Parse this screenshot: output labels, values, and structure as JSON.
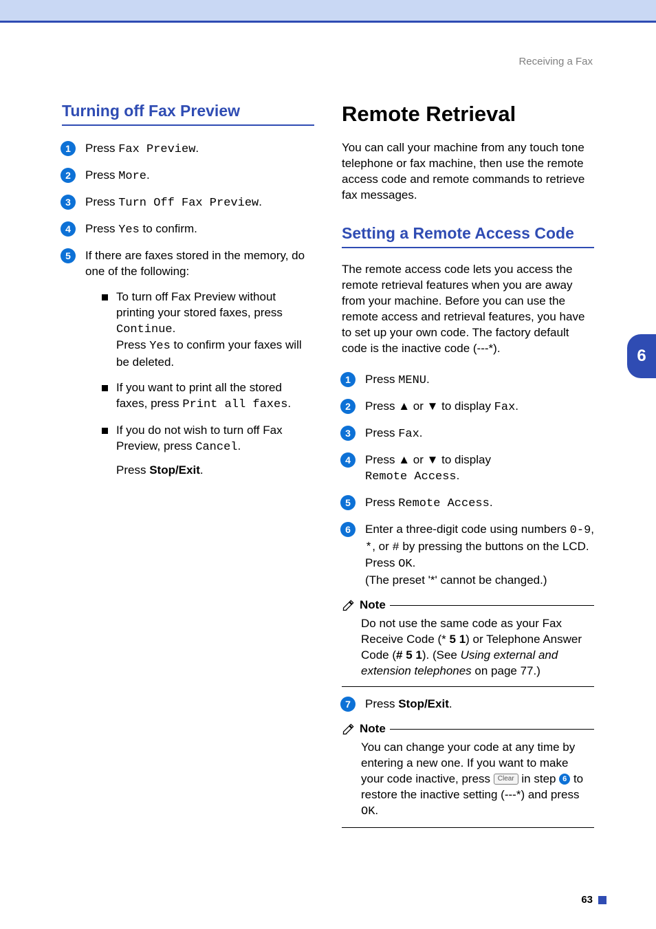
{
  "header": {
    "section": "Receiving a Fax"
  },
  "left": {
    "heading": "Turning off Fax Preview",
    "steps": {
      "s1": {
        "pre": "Press ",
        "mono": "Fax Preview",
        "post": "."
      },
      "s2": {
        "pre": "Press ",
        "mono": "More",
        "post": "."
      },
      "s3": {
        "pre": "Press ",
        "mono": "Turn Off Fax Preview",
        "post": "."
      },
      "s4": {
        "pre": "Press ",
        "mono": "Yes",
        "post": " to confirm."
      },
      "s5": "If there are faxes stored in the memory, do one of the following:"
    },
    "bullets": {
      "b1": {
        "l1a": "To turn off Fax Preview without printing your stored faxes, press ",
        "l1m": "Continue",
        "l1p": ".",
        "l2a": "Press ",
        "l2m": "Yes",
        "l2p": " to confirm your faxes will be deleted."
      },
      "b2": {
        "a": "If you want to print all the stored faxes, press ",
        "m": "Print all faxes",
        "p": "."
      },
      "b3": {
        "a": "If you do not wish to turn off Fax Preview, press ",
        "m": "Cancel",
        "p": ".",
        "l2a": "Press ",
        "l2b": "Stop/Exit",
        "l2p": "."
      }
    }
  },
  "right": {
    "h1": "Remote Retrieval",
    "intro": "You can call your machine from any touch tone telephone or fax machine, then use the remote access code and remote commands to retrieve fax messages.",
    "h3": "Setting a Remote Access Code",
    "intro2a": "The remote access code lets you access the remote retrieval features when you are away from your machine. Before you can use the remote access and retrieval features, you have to set up your own code. The factory default code is the inactive code (---",
    "intro2star": "l",
    "intro2b": ").",
    "steps": {
      "s1": {
        "pre": "Press ",
        "mono": "MENU",
        "post": "."
      },
      "s2": {
        "pre": "Press ",
        "arrows": "a or b",
        "mid": " to display ",
        "mono": "Fax",
        "post": "."
      },
      "s3": {
        "pre": "Press ",
        "mono": "Fax",
        "post": "."
      },
      "s4": {
        "pre": "Press ",
        "arrows": "a or b",
        "mid": " to display ",
        "mono": "Remote Access",
        "post": "."
      },
      "s5": {
        "pre": "Press ",
        "mono": "Remote Access",
        "post": "."
      },
      "s6": {
        "l1a": "Enter a three-digit code using numbers ",
        "l1m": "0-9",
        "l1b": ", ",
        "l1s": "l",
        "l1c": ", or ",
        "l1h": "#",
        "l1d": " by pressing the buttons on the LCD.",
        "l2a": "Press ",
        "l2m": "OK",
        "l2p": ".",
        "l3a": "(The preset '",
        "l3s": "l",
        "l3b": "' cannot be changed.)"
      },
      "s7": {
        "pre": "Press ",
        "bold": "Stop/Exit",
        "post": "."
      }
    },
    "note1": {
      "title": "Note",
      "a": "Do not use the same code as your Fax Receive Code (",
      "s1": "l",
      "b": " ",
      "c": "5 1",
      "d": ") or Telephone Answer Code (",
      "e": "# 5 1",
      "f": "). (See ",
      "g": "Using external and extension telephones",
      "h": " on page 77.)"
    },
    "note2": {
      "title": "Note",
      "a": "You can change your code at any time by entering a new one. If you want to make your code inactive, press ",
      "clear": "Clear",
      "b": " in step ",
      "step": "f",
      "c": " to restore the inactive setting (---",
      "s": "l",
      "d": ") and press ",
      "m": "OK",
      "e": "."
    }
  },
  "sidetab": "6",
  "pagenum": "63"
}
